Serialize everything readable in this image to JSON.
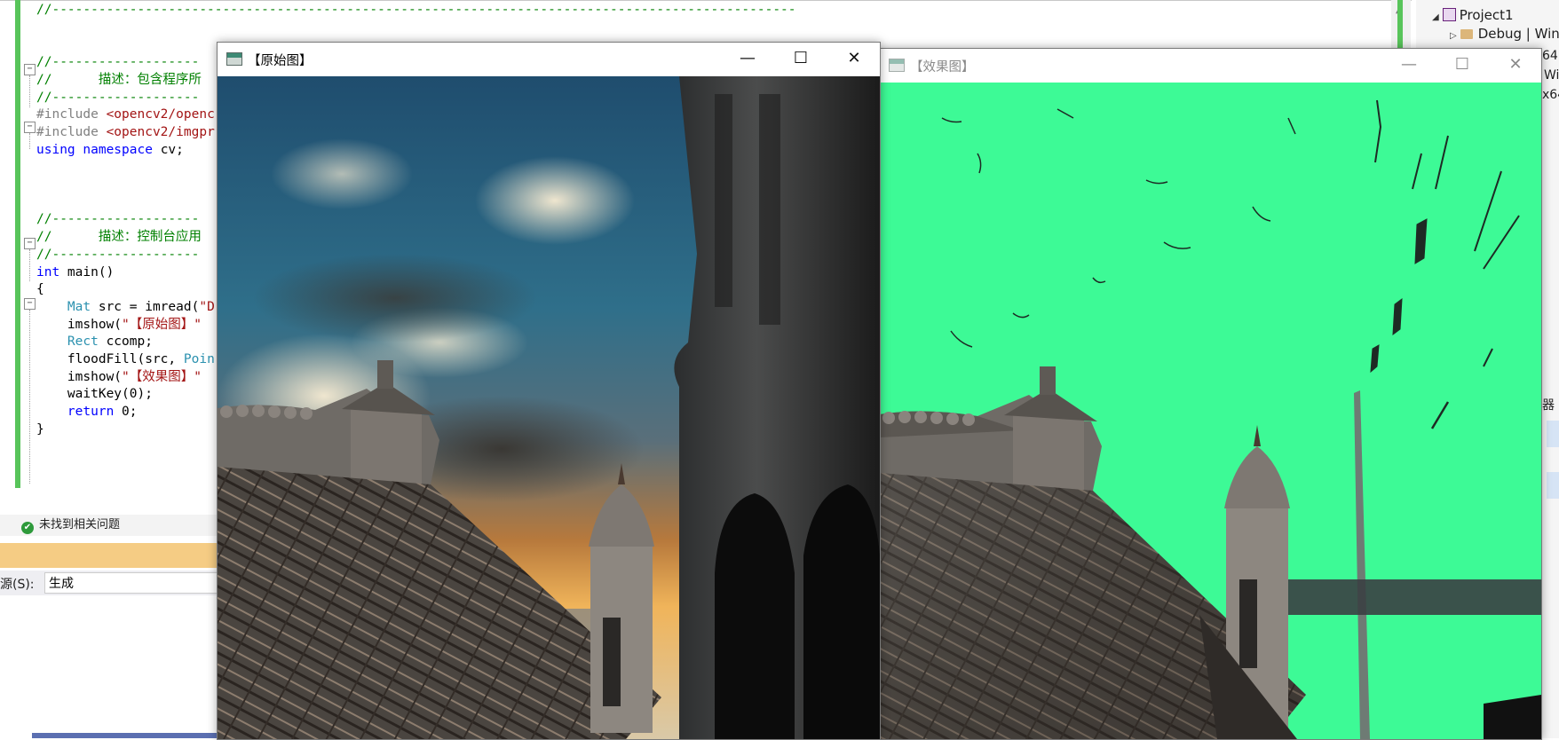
{
  "editor": {
    "code_lines": [
      {
        "tokens": [
          {
            "t": "//------------------------------------------------------------------------------------------------",
            "c": "cmt"
          }
        ]
      },
      {
        "tokens": []
      },
      {
        "tokens": []
      },
      {
        "tokens": [
          {
            "t": "//-------------------",
            "c": "cmt"
          }
        ]
      },
      {
        "tokens": [
          {
            "t": "//      描述：包含程序所",
            "c": "cmt"
          }
        ]
      },
      {
        "tokens": [
          {
            "t": "//-------------------",
            "c": "cmt"
          }
        ]
      },
      {
        "tokens": [
          {
            "t": "#include ",
            "c": "pp"
          },
          {
            "t": "<opencv2/openc",
            "c": "str"
          }
        ]
      },
      {
        "tokens": [
          {
            "t": "#include ",
            "c": "pp"
          },
          {
            "t": "<opencv2/imgpr",
            "c": "str"
          }
        ]
      },
      {
        "tokens": [
          {
            "t": "using ",
            "c": "kw"
          },
          {
            "t": "namespace ",
            "c": "kw"
          },
          {
            "t": "cv;",
            "c": ""
          }
        ]
      },
      {
        "tokens": []
      },
      {
        "tokens": []
      },
      {
        "tokens": []
      },
      {
        "tokens": [
          {
            "t": "//-------------------",
            "c": "cmt"
          }
        ]
      },
      {
        "tokens": [
          {
            "t": "//      描述：控制台应用",
            "c": "cmt"
          }
        ]
      },
      {
        "tokens": [
          {
            "t": "//-------------------",
            "c": "cmt"
          }
        ]
      },
      {
        "tokens": [
          {
            "t": "int ",
            "c": "kw"
          },
          {
            "t": "main()",
            "c": ""
          }
        ]
      },
      {
        "tokens": [
          {
            "t": "{",
            "c": ""
          }
        ]
      },
      {
        "tokens": [
          {
            "t": "    ",
            "c": ""
          },
          {
            "t": "Mat ",
            "c": "typ"
          },
          {
            "t": "src = imread(",
            "c": ""
          },
          {
            "t": "\"D",
            "c": "str"
          }
        ]
      },
      {
        "tokens": [
          {
            "t": "    imshow(",
            "c": ""
          },
          {
            "t": "\"【原始图】\"",
            "c": "str"
          }
        ]
      },
      {
        "tokens": [
          {
            "t": "    ",
            "c": ""
          },
          {
            "t": "Rect ",
            "c": "typ"
          },
          {
            "t": "ccomp;",
            "c": ""
          }
        ]
      },
      {
        "tokens": [
          {
            "t": "    floodFill(src, ",
            "c": ""
          },
          {
            "t": "Poin",
            "c": "typ"
          }
        ]
      },
      {
        "tokens": [
          {
            "t": "    imshow(",
            "c": ""
          },
          {
            "t": "\"【效果图】\"",
            "c": "str"
          }
        ]
      },
      {
        "tokens": [
          {
            "t": "    waitKey(0);",
            "c": ""
          }
        ]
      },
      {
        "tokens": [
          {
            "t": "    ",
            "c": ""
          },
          {
            "t": "return ",
            "c": "kw"
          },
          {
            "t": "0;",
            "c": ""
          }
        ]
      },
      {
        "tokens": [
          {
            "t": "}",
            "c": ""
          }
        ]
      }
    ]
  },
  "status": {
    "no_issues": "未找到相关问题"
  },
  "output": {
    "source_label": "来源(S):",
    "source_value": "生成",
    "source_label_visible": "源(S):"
  },
  "solution_explorer": {
    "project": "Project1",
    "debug_item": "Debug | Win",
    "clipped": [
      "64",
      "Wi",
      "x64",
      "器"
    ]
  },
  "windows": {
    "original": {
      "title": "【原始图】"
    },
    "effect": {
      "title": "【效果图】",
      "fill_color": "#3dfa96"
    }
  },
  "window_buttons": {
    "minimize": "—",
    "maximize": "☐",
    "close": "✕"
  }
}
